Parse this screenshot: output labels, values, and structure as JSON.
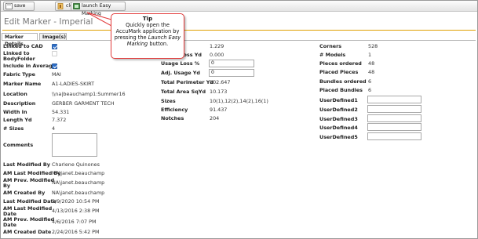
{
  "toolbar": {
    "save_label": "save",
    "close_label": "close",
    "easy_label": "launch Easy Marking"
  },
  "page_title": "Edit Marker - Imperial",
  "tabs": [
    "Marker Details",
    "Image(s)"
  ],
  "tooltip": {
    "title": "Tip",
    "line1": "Quickly open the",
    "line2": "AccuMark application by",
    "line3a": "pressing the",
    "line3b": "Launch Easy",
    "line4a": "Marking",
    "line4b": "button."
  },
  "col1": {
    "linked_cad": "Linked to CAD",
    "linked_body_1": "Linked to",
    "linked_body_2": "BodyFolder",
    "include_avg": "Include in Average",
    "fabric_type": "Fabric Type",
    "fabric_type_val": "MAI",
    "marker_name": "Marker Name",
    "marker_name_val": "A1-LADIES-SKIRT",
    "location": "Location",
    "location_val": "\\\\na|beauchamp1:Summer16",
    "description": "Description",
    "description_val": "GERBER GARMENT TECH",
    "width_in": "Width In",
    "width_in_val": "54.331",
    "length_yd": "Length Yd",
    "length_yd_val": "7.372",
    "num_sizes": "# Sizes",
    "num_sizes_val": "4",
    "comments": "Comments",
    "last_mod_by": "Last Modified By",
    "last_mod_by_val": "Charlene Quinones",
    "am_last_mod_by": "AM Last Modified By",
    "am_last_mod_by_val": "NA\\janet.beauchamp",
    "am_prev_mod_by_1": "AM Prev. Modified",
    "am_prev_mod_by_2": "By",
    "am_prev_mod_by_val": "NA\\janet.beauchamp",
    "am_created_by": "AM Created By",
    "am_created_by_val": "NA\\janet.beauchamp",
    "last_mod_date": "Last Modified Date",
    "last_mod_date_val": "3/9/2020 10:54 PM",
    "am_last_mod_date_1": "AM Last Modified",
    "am_last_mod_date_2": "Date",
    "am_last_mod_date_val": "4/13/2016 2:38 PM",
    "am_prev_mod_date_1": "AM Prev. Modified",
    "am_prev_mod_date_2": "Date",
    "am_prev_mod_date_val": "4/6/2016 7:07 PM",
    "am_created_date": "AM Created Date",
    "am_created_date_val": "2/24/2016 5:42 PM"
  },
  "col2": {
    "top_val": "1.229",
    "unmarked_partial": "Usage Loss Yd",
    "unmarked_val": "0.000",
    "usage_loss_pct": "Usage Loss %",
    "usage_loss_pct_val": "0",
    "adj_usage_yd": "Adj. Usage Yd",
    "adj_usage_yd_val": "0",
    "total_perim": "Total Perimeter Yd",
    "total_perim_val": "102.647",
    "total_area": "Total Area SqYd",
    "total_area_val": "10.173",
    "sizes": "Sizes",
    "sizes_val": "10(1),12(2),14(2),16(1)",
    "efficiency": "Efficiency",
    "efficiency_val": "91.437",
    "notches": "Notches",
    "notches_val": "204"
  },
  "col3": {
    "corners": "Corners",
    "corners_val": "528",
    "models": "# Models",
    "models_val": "1",
    "pieces_ordered": "Pieces ordered",
    "pieces_ordered_val": "48",
    "placed_pieces": "Placed Pieces",
    "placed_pieces_val": "48",
    "bundles_ordered": "Bundles ordered",
    "bundles_ordered_val": "6",
    "placed_bundles": "Placed Bundles",
    "placed_bundles_val": "6",
    "ud1": "UserDefined1",
    "ud2": "UserDefined2",
    "ud3": "UserDefined3",
    "ud4": "UserDefined4",
    "ud5": "UserDefined5"
  },
  "colors": {
    "accent_rule": "#e0a000",
    "tooltip_border": "#e23b3b",
    "checkbox": "#2f6fc7"
  }
}
